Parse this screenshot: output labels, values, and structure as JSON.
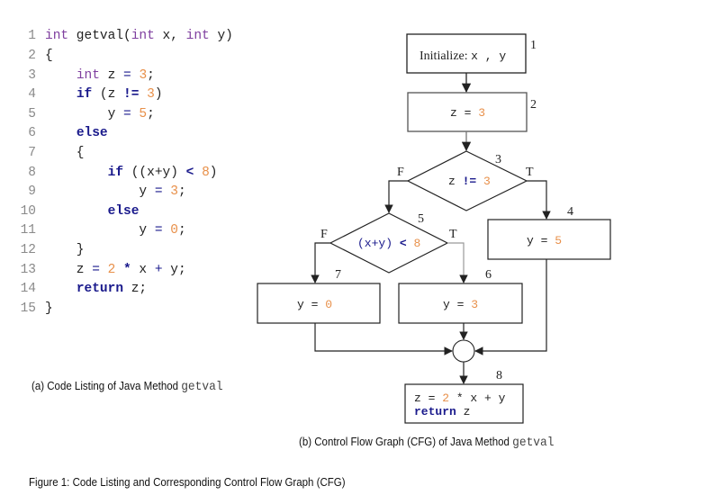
{
  "code_listing": {
    "lines": [
      {
        "no": "1",
        "tokens": [
          {
            "t": "int",
            "c": "kw-purple"
          },
          {
            "t": " getval(",
            "c": "plain"
          },
          {
            "t": "int",
            "c": "kw-purple"
          },
          {
            "t": " x, ",
            "c": "plain"
          },
          {
            "t": "int",
            "c": "kw-purple"
          },
          {
            "t": " y)",
            "c": "plain"
          }
        ]
      },
      {
        "no": "2",
        "tokens": [
          {
            "t": "{",
            "c": "plain"
          }
        ]
      },
      {
        "no": "3",
        "tokens": [
          {
            "t": "    ",
            "c": "plain"
          },
          {
            "t": "int",
            "c": "kw-purple"
          },
          {
            "t": " z ",
            "c": "plain"
          },
          {
            "t": "=",
            "c": "op"
          },
          {
            "t": " ",
            "c": "plain"
          },
          {
            "t": "3",
            "c": "num"
          },
          {
            "t": ";",
            "c": "plain"
          }
        ]
      },
      {
        "no": "4",
        "tokens": [
          {
            "t": "    ",
            "c": "plain"
          },
          {
            "t": "if",
            "c": "kw-blue"
          },
          {
            "t": " (z ",
            "c": "plain"
          },
          {
            "t": "!=",
            "c": "kw-blue"
          },
          {
            "t": " ",
            "c": "plain"
          },
          {
            "t": "3",
            "c": "num"
          },
          {
            "t": ")",
            "c": "plain"
          }
        ]
      },
      {
        "no": "5",
        "tokens": [
          {
            "t": "        y ",
            "c": "plain"
          },
          {
            "t": "=",
            "c": "op"
          },
          {
            "t": " ",
            "c": "plain"
          },
          {
            "t": "5",
            "c": "num"
          },
          {
            "t": ";",
            "c": "plain"
          }
        ]
      },
      {
        "no": "6",
        "tokens": [
          {
            "t": "    ",
            "c": "plain"
          },
          {
            "t": "else",
            "c": "kw-blue"
          }
        ]
      },
      {
        "no": "7",
        "tokens": [
          {
            "t": "    {",
            "c": "plain"
          }
        ]
      },
      {
        "no": "8",
        "tokens": [
          {
            "t": "        ",
            "c": "plain"
          },
          {
            "t": "if",
            "c": "kw-blue"
          },
          {
            "t": " ((x+y) ",
            "c": "plain"
          },
          {
            "t": "<",
            "c": "kw-blue"
          },
          {
            "t": " ",
            "c": "plain"
          },
          {
            "t": "8",
            "c": "num"
          },
          {
            "t": ")",
            "c": "plain"
          }
        ]
      },
      {
        "no": "9",
        "tokens": [
          {
            "t": "            y ",
            "c": "plain"
          },
          {
            "t": "=",
            "c": "op"
          },
          {
            "t": " ",
            "c": "plain"
          },
          {
            "t": "3",
            "c": "num"
          },
          {
            "t": ";",
            "c": "plain"
          }
        ]
      },
      {
        "no": "10",
        "tokens": [
          {
            "t": "        ",
            "c": "plain"
          },
          {
            "t": "else",
            "c": "kw-blue"
          }
        ]
      },
      {
        "no": "11",
        "tokens": [
          {
            "t": "            y ",
            "c": "plain"
          },
          {
            "t": "=",
            "c": "op"
          },
          {
            "t": " ",
            "c": "plain"
          },
          {
            "t": "0",
            "c": "num"
          },
          {
            "t": ";",
            "c": "plain"
          }
        ]
      },
      {
        "no": "12",
        "tokens": [
          {
            "t": "    }",
            "c": "plain"
          }
        ]
      },
      {
        "no": "13",
        "tokens": [
          {
            "t": "    z ",
            "c": "plain"
          },
          {
            "t": "=",
            "c": "op"
          },
          {
            "t": " ",
            "c": "plain"
          },
          {
            "t": "2",
            "c": "num"
          },
          {
            "t": " ",
            "c": "plain"
          },
          {
            "t": "*",
            "c": "kw-blue"
          },
          {
            "t": " x ",
            "c": "plain"
          },
          {
            "t": "+",
            "c": "op"
          },
          {
            "t": " y;",
            "c": "plain"
          }
        ]
      },
      {
        "no": "14",
        "tokens": [
          {
            "t": "    ",
            "c": "plain"
          },
          {
            "t": "return",
            "c": "kw-blue"
          },
          {
            "t": " z;",
            "c": "plain"
          }
        ]
      },
      {
        "no": "15",
        "tokens": [
          {
            "t": "}",
            "c": "plain"
          }
        ]
      }
    ]
  },
  "captions": {
    "a_prefix": "(a)  Code Listing of Java Method ",
    "a_method": "getval",
    "b_prefix": "(b)  Control Flow Graph (CFG) of Java Method ",
    "b_method": "getval",
    "figure": "Figure 1: Code Listing and Corresponding  Control Flow Graph (CFG)"
  },
  "cfg": {
    "nodes": {
      "n1": {
        "label": "1",
        "text_prefix": "Initialize: ",
        "text_vars": "x , y"
      },
      "n2": {
        "label": "2",
        "lhs": "z  = ",
        "num": "3"
      },
      "n3": {
        "label": "3",
        "lhs": "z  != ",
        "num": "3"
      },
      "n4": {
        "label": "4",
        "lhs": "y  =  ",
        "num": "5"
      },
      "n5": {
        "label": "5",
        "lhs": "(x+y) < ",
        "num": "8"
      },
      "n6": {
        "label": "6",
        "lhs": "y  =  ",
        "num": "3"
      },
      "n7": {
        "label": "7",
        "lhs": "y  =  ",
        "num": "0"
      },
      "n8": {
        "label": "8",
        "line1_a": "z  =  ",
        "line1_num": "2",
        "line1_b": " * x  +  y",
        "line2_kw": "return",
        "line2_rest": " z"
      }
    },
    "branch_labels": {
      "n3_false": "F",
      "n3_true": "T",
      "n5_false": "F",
      "n5_true": "T"
    },
    "colors": {
      "number": "#e8904a",
      "keyword": "#1a1a8c",
      "text": "#222222",
      "stroke": "#222222"
    }
  }
}
